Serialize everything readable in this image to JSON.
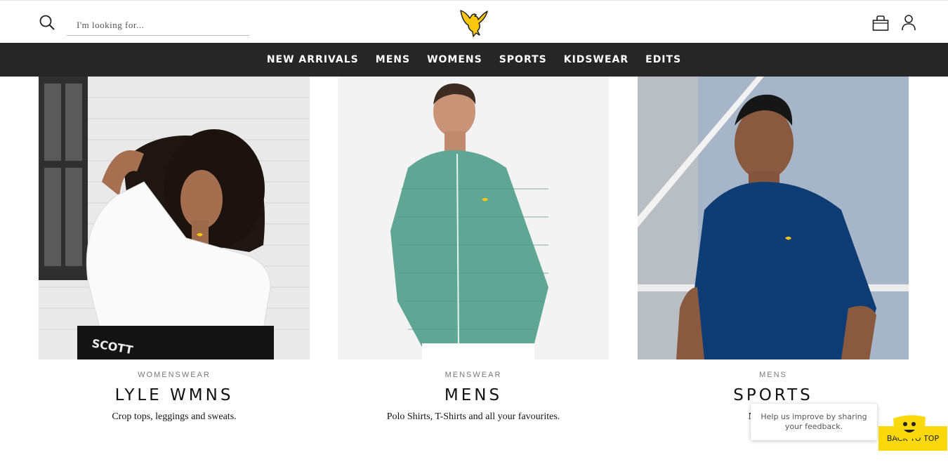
{
  "header": {
    "search": {
      "placeholder": "I'm looking for...",
      "value": ""
    },
    "brand_color": "#f9c80e"
  },
  "nav": {
    "items": [
      "NEW ARRIVALS",
      "MENS",
      "WOMENS",
      "SPORTS",
      "KIDSWEAR",
      "EDITS"
    ],
    "background": "#262626"
  },
  "cards": [
    {
      "category": "WOMENSWEAR",
      "title": "LYLE WMNS",
      "description": "Crop tops, leggings and sweats.",
      "image_text": "SCOTT"
    },
    {
      "category": "MENSWEAR",
      "title": "MENS",
      "description": "Polo Shirts, T-Shirts and all your favourites."
    },
    {
      "category": "MENS",
      "title": "SPORTS",
      "description": "New drop fo"
    }
  ],
  "feedback": {
    "text": "Help us improve by sharing your feedback."
  },
  "back_to_top": {
    "label": "BACK TO TOP"
  }
}
